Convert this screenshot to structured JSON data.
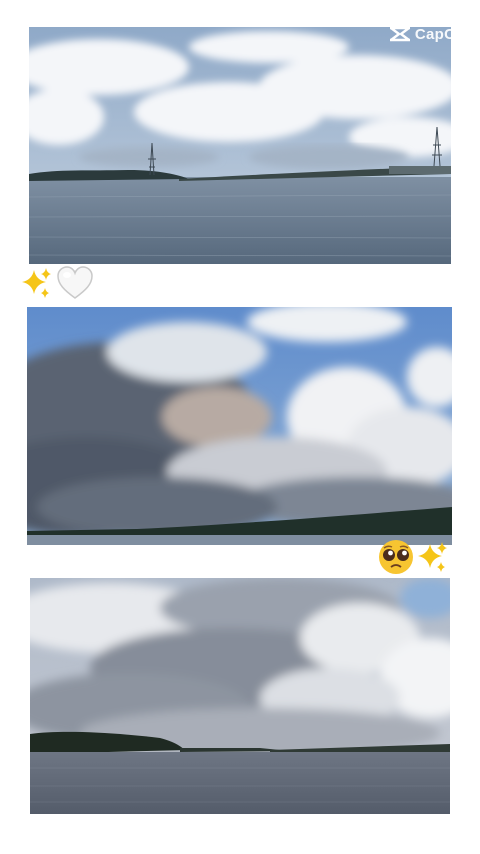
{
  "watermark": {
    "text": "CapCut",
    "icon": "capcut-logo-icon"
  },
  "stickers": {
    "row1": [
      "sparkles-icon",
      "white-heart-icon"
    ],
    "row2": [
      "pleading-face-icon",
      "sparkles-icon"
    ]
  },
  "photos": [
    {
      "icon": "river-with-towers-photo"
    },
    {
      "icon": "storm-clouds-photo"
    },
    {
      "icon": "cloudy-river-photo"
    }
  ],
  "colors": {
    "background": "#ffffff",
    "sky_blue": "#6f95c8",
    "water": "#6e7f90"
  }
}
